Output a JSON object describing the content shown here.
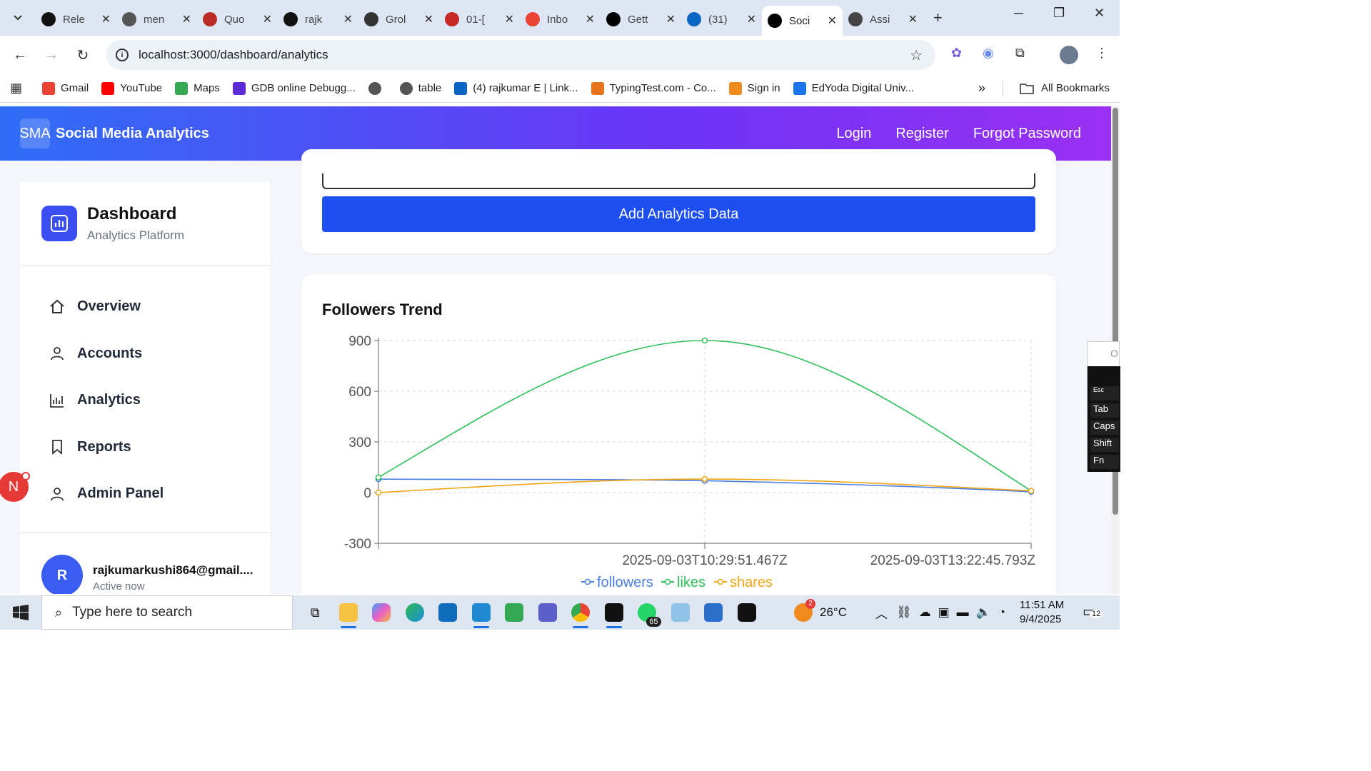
{
  "browser": {
    "tabs": [
      {
        "title": "Rele",
        "icon": "github-icon",
        "color": "#111111"
      },
      {
        "title": "men",
        "icon": "globe-icon",
        "color": "#555555"
      },
      {
        "title": "Quo",
        "icon": "quora-icon",
        "color": "#b92b27"
      },
      {
        "title": "rajk",
        "icon": "github-icon",
        "color": "#111111"
      },
      {
        "title": "Grol",
        "icon": "grok-icon",
        "color": "#333333"
      },
      {
        "title": "01-[",
        "icon": "pdf-icon",
        "color": "#c62828"
      },
      {
        "title": "Inbo",
        "icon": "gmail-icon",
        "color": "#ea4335"
      },
      {
        "title": "Gett",
        "icon": "nextjs-icon",
        "color": "#000000"
      },
      {
        "title": "(31)",
        "icon": "linkedin-icon",
        "color": "#0a66c2"
      },
      {
        "title": "Soci",
        "icon": "vercel-icon",
        "color": "#000000",
        "active": true
      },
      {
        "title": "Assi",
        "icon": "openai-icon",
        "color": "#444444"
      }
    ],
    "url": "localhost:3000/dashboard/analytics",
    "bookmarks": [
      {
        "label": "Gmail",
        "icon": "gmail-icon",
        "color": "#ea4335"
      },
      {
        "label": "YouTube",
        "icon": "youtube-icon",
        "color": "#ff0000"
      },
      {
        "label": "Maps",
        "icon": "maps-icon",
        "color": "#34a853"
      },
      {
        "label": "GDB online Debugg...",
        "icon": "gdb-icon",
        "color": "#5b2bd6"
      },
      {
        "label": "",
        "icon": "globe-icon",
        "color": "#555555"
      },
      {
        "label": "table",
        "icon": "globe-icon",
        "color": "#555555"
      },
      {
        "label": "(4) rajkumar E | Link...",
        "icon": "linkedin-icon",
        "color": "#0a66c2"
      },
      {
        "label": "TypingTest.com - Co...",
        "icon": "typingtest-icon",
        "color": "#e8731d"
      },
      {
        "label": "Sign in",
        "icon": "aws-icon",
        "color": "#f08a1c"
      },
      {
        "label": "EdYoda Digital Univ...",
        "icon": "edyoda-icon",
        "color": "#1a73e8"
      }
    ],
    "all_bookmarks": "All Bookmarks",
    "more_bookmarks": "»"
  },
  "app": {
    "logo": "SMA",
    "title": "Social Media Analytics",
    "nav": {
      "login": "Login",
      "register": "Register",
      "forgot": "Forgot Password"
    }
  },
  "sidebar": {
    "title": "Dashboard",
    "subtitle": "Analytics Platform",
    "items": [
      {
        "label": "Overview",
        "icon": "home-icon"
      },
      {
        "label": "Accounts",
        "icon": "user-icon"
      },
      {
        "label": "Analytics",
        "icon": "bar-chart-icon"
      },
      {
        "label": "Reports",
        "icon": "bookmark-icon"
      },
      {
        "label": "Admin Panel",
        "icon": "user-icon"
      }
    ],
    "user": {
      "initial": "R",
      "email": "rajkumarkushi864@gmail....",
      "status": "Active now"
    },
    "floating_avatar": "N"
  },
  "form": {
    "submit_label": "Add Analytics Data"
  },
  "chart_data": {
    "type": "line",
    "title": "Followers Trend",
    "x": [
      "",
      "2025-09-03T10:29:51.467Z",
      "2025-09-03T13:22:45.793Z"
    ],
    "series": [
      {
        "name": "followers",
        "color": "#4a7fe0",
        "values": [
          80,
          70,
          5
        ]
      },
      {
        "name": "likes",
        "color": "#2ec05a",
        "values": [
          90,
          900,
          10
        ]
      },
      {
        "name": "shares",
        "color": "#f2a516",
        "values": [
          0,
          80,
          10
        ]
      }
    ],
    "yticks": [
      900,
      600,
      300,
      0,
      -300
    ],
    "ylim": [
      -300,
      900
    ],
    "grid": true,
    "legend": "bottom"
  },
  "taskbar": {
    "search_placeholder": "Type here to search",
    "weather": "26°C",
    "weather_badge": "2",
    "whatsapp_badge": "65",
    "time": "11:51 AM",
    "date": "9/4/2025",
    "notif_count": "12"
  },
  "osk": {
    "keys": [
      "Esc",
      "Tab",
      "Caps",
      "Shift",
      "Fn"
    ]
  }
}
